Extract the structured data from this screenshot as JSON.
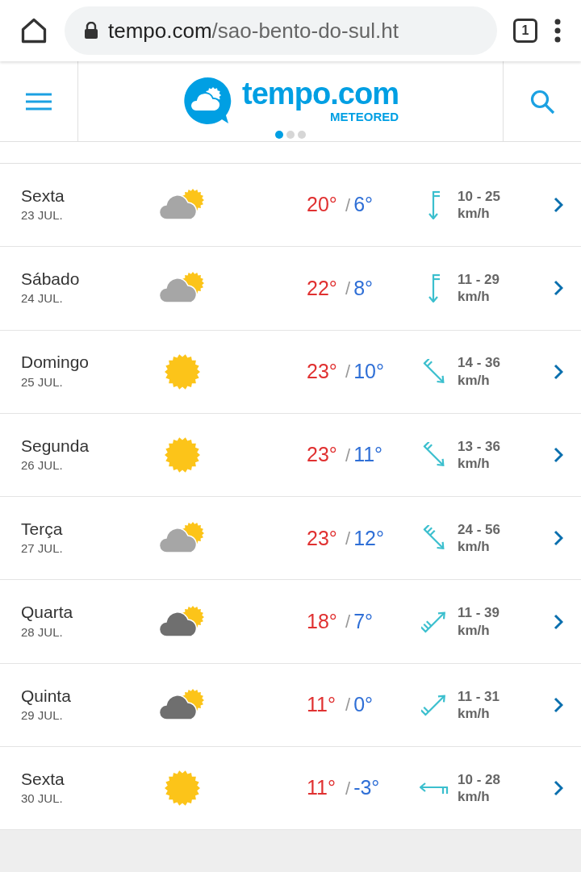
{
  "browser": {
    "url_host": "tempo.com",
    "url_path": "/sao-bento-do-sul.ht",
    "tab_count": "1"
  },
  "header": {
    "logo_text": "tempo.com",
    "logo_subtext": "METEORED",
    "carousel_dots": [
      {
        "selected": true
      },
      {
        "selected": false
      },
      {
        "selected": false
      }
    ]
  },
  "days": [
    {
      "day": "Sexta",
      "date": "23 JUL.",
      "icon": {
        "kind": "partly_cloudy"
      },
      "high": "20°",
      "separator": "/",
      "low": "6°",
      "wind": {
        "arrow": {
          "kind": "south2"
        },
        "speed": "10 - 25",
        "unit": "km/h"
      }
    },
    {
      "day": "Sábado",
      "date": "24 JUL.",
      "icon": {
        "kind": "partly_cloudy"
      },
      "high": "22°",
      "separator": "/",
      "low": "8°",
      "wind": {
        "arrow": {
          "kind": "south2"
        },
        "speed": "11 - 29",
        "unit": "km/h"
      }
    },
    {
      "day": "Domingo",
      "date": "25 JUL.",
      "icon": {
        "kind": "sunny"
      },
      "high": "23°",
      "separator": "/",
      "low": "10°",
      "wind": {
        "arrow": {
          "kind": "southeast2"
        },
        "speed": "14 - 36",
        "unit": "km/h"
      }
    },
    {
      "day": "Segunda",
      "date": "26 JUL.",
      "icon": {
        "kind": "sunny"
      },
      "high": "23°",
      "separator": "/",
      "low": "11°",
      "wind": {
        "arrow": {
          "kind": "southeast2"
        },
        "speed": "13 - 36",
        "unit": "km/h"
      }
    },
    {
      "day": "Terça",
      "date": "27 JUL.",
      "icon": {
        "kind": "partly_cloudy"
      },
      "high": "23°",
      "separator": "/",
      "low": "12°",
      "wind": {
        "arrow": {
          "kind": "southeast3"
        },
        "speed": "24 - 56",
        "unit": "km/h"
      }
    },
    {
      "day": "Quarta",
      "date": "28 JUL.",
      "icon": {
        "kind": "dark_cloudy"
      },
      "high": "18°",
      "separator": "/",
      "low": "7°",
      "wind": {
        "arrow": {
          "kind": "northeast3"
        },
        "speed": "11 - 39",
        "unit": "km/h"
      }
    },
    {
      "day": "Quinta",
      "date": "29 JUL.",
      "icon": {
        "kind": "dark_cloudy"
      },
      "high": "11°",
      "separator": "/",
      "low": "0°",
      "wind": {
        "arrow": {
          "kind": "northeast2"
        },
        "speed": "11 - 31",
        "unit": "km/h"
      }
    },
    {
      "day": "Sexta",
      "date": "30 JUL.",
      "icon": {
        "kind": "sunny"
      },
      "high": "11°",
      "separator": "/",
      "low": "-3°",
      "wind": {
        "arrow": {
          "kind": "west2"
        },
        "speed": "10 - 28",
        "unit": "km/h"
      }
    }
  ]
}
